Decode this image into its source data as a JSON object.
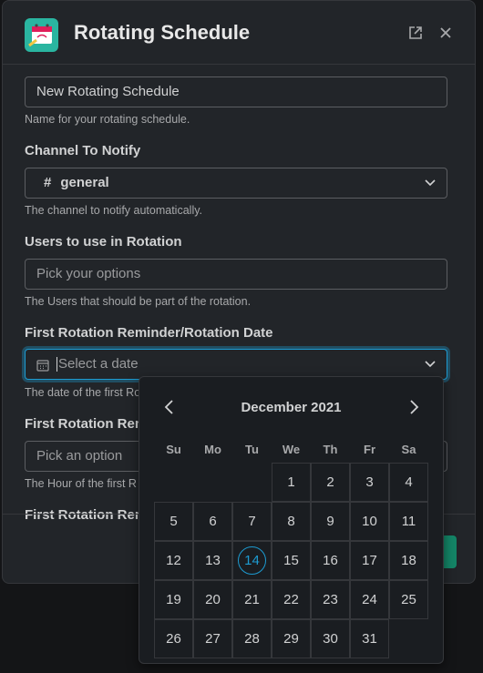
{
  "modal": {
    "title": "Rotating Schedule",
    "icon": "calendar-app-icon",
    "accent": "#1d9bd1"
  },
  "fields": {
    "schedule_name": {
      "value": "New Rotating Schedule",
      "hint": "Name for your rotating schedule."
    },
    "channel": {
      "label": "Channel To Notify",
      "value": "general",
      "prefix": "#",
      "hint": "The channel to notify automatically."
    },
    "users": {
      "label": "Users to use in Rotation",
      "placeholder": "Pick your options",
      "hint": "The Users that should be part of the rotation."
    },
    "date": {
      "label": "First Rotation Reminder/Rotation Date",
      "placeholder": "Select a date",
      "hint": "The date of the first Ro"
    },
    "hour": {
      "label": "First Rotation Remi",
      "placeholder": "Pick an option",
      "hint": "The Hour of the first R"
    },
    "next": {
      "label": "First Rotation Remi"
    }
  },
  "calendar": {
    "month": "December 2021",
    "weekdays": [
      "Su",
      "Mo",
      "Tu",
      "We",
      "Th",
      "Fr",
      "Sa"
    ],
    "first_weekday": 3,
    "days_in_month": 31,
    "today": 14
  }
}
